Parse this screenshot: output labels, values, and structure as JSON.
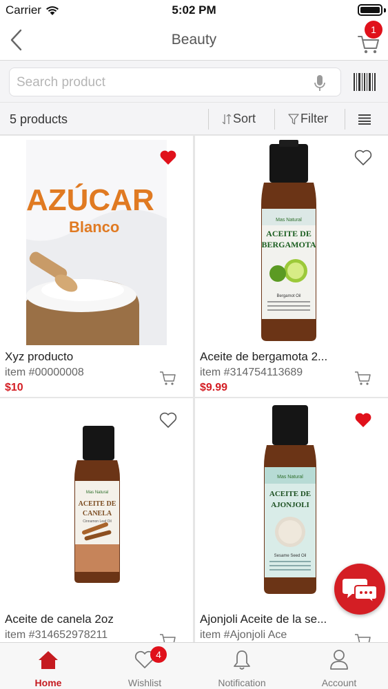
{
  "status_bar": {
    "carrier": "Carrier",
    "time": "5:02 PM"
  },
  "nav": {
    "title": "Beauty",
    "cart_count": "1"
  },
  "search": {
    "placeholder": "Search product",
    "value": ""
  },
  "toolbar": {
    "count_label": "5 products",
    "sort_label": "Sort",
    "filter_label": "Filter"
  },
  "products": [
    {
      "name": "Xyz producto",
      "sku": "item #00000008",
      "price": "$10",
      "favorite": true
    },
    {
      "name": "Aceite de bergamota 2...",
      "sku": "item #314754113689",
      "price": "$9.99",
      "favorite": false,
      "label": {
        "brand": "Mas Natural",
        "line1": "ACEITE DE",
        "line2": "BERGAMOTA",
        "sub": "Bergamot Oil"
      }
    },
    {
      "name": "Aceite de canela 2oz",
      "sku": "item #314652978211",
      "price": "",
      "favorite": false,
      "label": {
        "brand": "Mas Natural",
        "line1": "ACEITE DE",
        "line2": "CANELA",
        "sub": "Cinnamon Leaf Oil"
      }
    },
    {
      "name": "Ajonjoli Aceite de la se...",
      "sku": "item #Ajonjoli Ace",
      "price": "",
      "favorite": true,
      "label": {
        "brand": "Mas Natural",
        "line1": "ACEITE DE",
        "line2": "AJONJOLI",
        "sub": "Sesame Seed Oil"
      }
    }
  ],
  "product_image_text": {
    "sugar_line1": "AZÚCAR",
    "sugar_line2": "Blanco"
  },
  "tabs": [
    {
      "label": "Home",
      "active": true
    },
    {
      "label": "Wishlist",
      "badge": "4"
    },
    {
      "label": "Notification"
    },
    {
      "label": "Account"
    }
  ],
  "colors": {
    "accent": "#d41e24",
    "badge": "#e0111b"
  }
}
